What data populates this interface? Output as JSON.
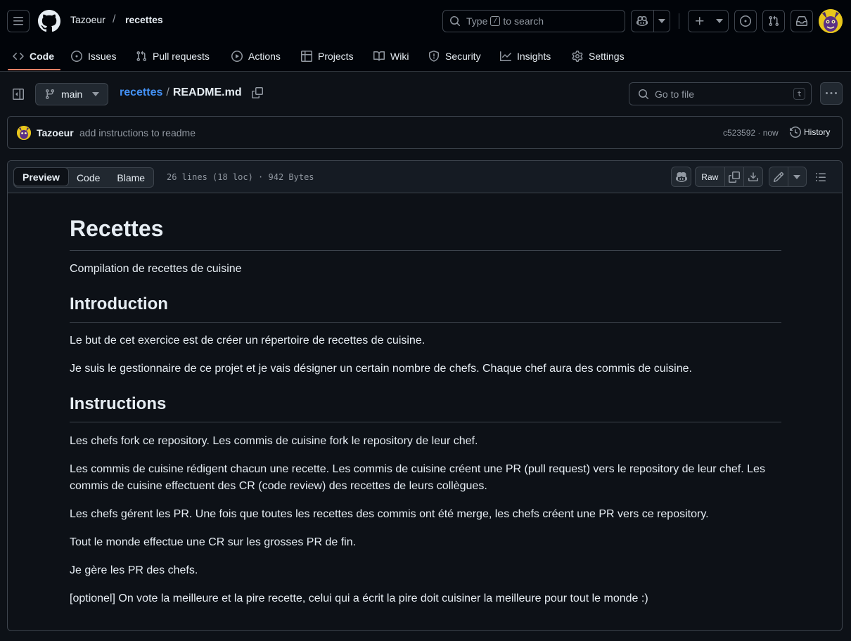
{
  "header": {
    "owner": "Tazoeur",
    "separator": "/",
    "repo": "recettes",
    "search": {
      "prefix": "Type",
      "key": "/",
      "suffix": "to search"
    }
  },
  "tabs": [
    {
      "label": "Code",
      "icon": "code-icon",
      "active": true
    },
    {
      "label": "Issues",
      "icon": "issue-opened-icon"
    },
    {
      "label": "Pull requests",
      "icon": "git-pull-request-icon"
    },
    {
      "label": "Actions",
      "icon": "play-icon"
    },
    {
      "label": "Projects",
      "icon": "table-icon"
    },
    {
      "label": "Wiki",
      "icon": "book-icon"
    },
    {
      "label": "Security",
      "icon": "shield-icon"
    },
    {
      "label": "Insights",
      "icon": "graph-icon"
    },
    {
      "label": "Settings",
      "icon": "gear-icon"
    }
  ],
  "file_nav": {
    "branch": "main",
    "crumb_repo": "recettes",
    "crumb_sep": "/",
    "file": "README.md",
    "go_to_file": "Go to file",
    "go_to_file_key": "t"
  },
  "commit": {
    "author": "Tazoeur",
    "message": "add instructions to readme",
    "meta": "c523592 · now",
    "history": "History"
  },
  "viewer": {
    "modes": [
      "Preview",
      "Code",
      "Blame"
    ],
    "active_mode": "Preview",
    "file_info": "26 lines (18 loc) · 942 Bytes",
    "raw": "Raw"
  },
  "readme": {
    "h1": "Recettes",
    "intro_line": "Compilation de recettes de cuisine",
    "h2_intro": "Introduction",
    "p1": "Le but de cet exercice est de créer un répertoire de recettes de cuisine.",
    "p2": "Je suis le gestionnaire de ce projet et je vais désigner un certain nombre de chefs. Chaque chef aura des commis de cuisine.",
    "h2_instr": "Instructions",
    "p3": "Les chefs fork ce repository. Les commis de cuisine fork le repository de leur chef.",
    "p4": "Les commis de cuisine rédigent chacun une recette. Les commis de cuisine créent une PR (pull request) vers le repository de leur chef. Les commis de cuisine effectuent des CR (code review) des recettes de leurs collègues.",
    "p5": "Les chefs gérent les PR. Une fois que toutes les recettes des commis ont été merge, les chefs créent une PR vers ce repository.",
    "p6": "Tout le monde effectue une CR sur les grosses PR de fin.",
    "p7": "Je gère les PR des chefs.",
    "p8": "[optionel] On vote la meilleure et la pire recette, celui qui a écrit la pire doit cuisiner la meilleure pour tout le monde :)"
  },
  "colors": {
    "background": "#0d1117",
    "header": "#010409",
    "accent_underline": "#f78166",
    "link": "#4493f8",
    "border": "#3d444d"
  }
}
